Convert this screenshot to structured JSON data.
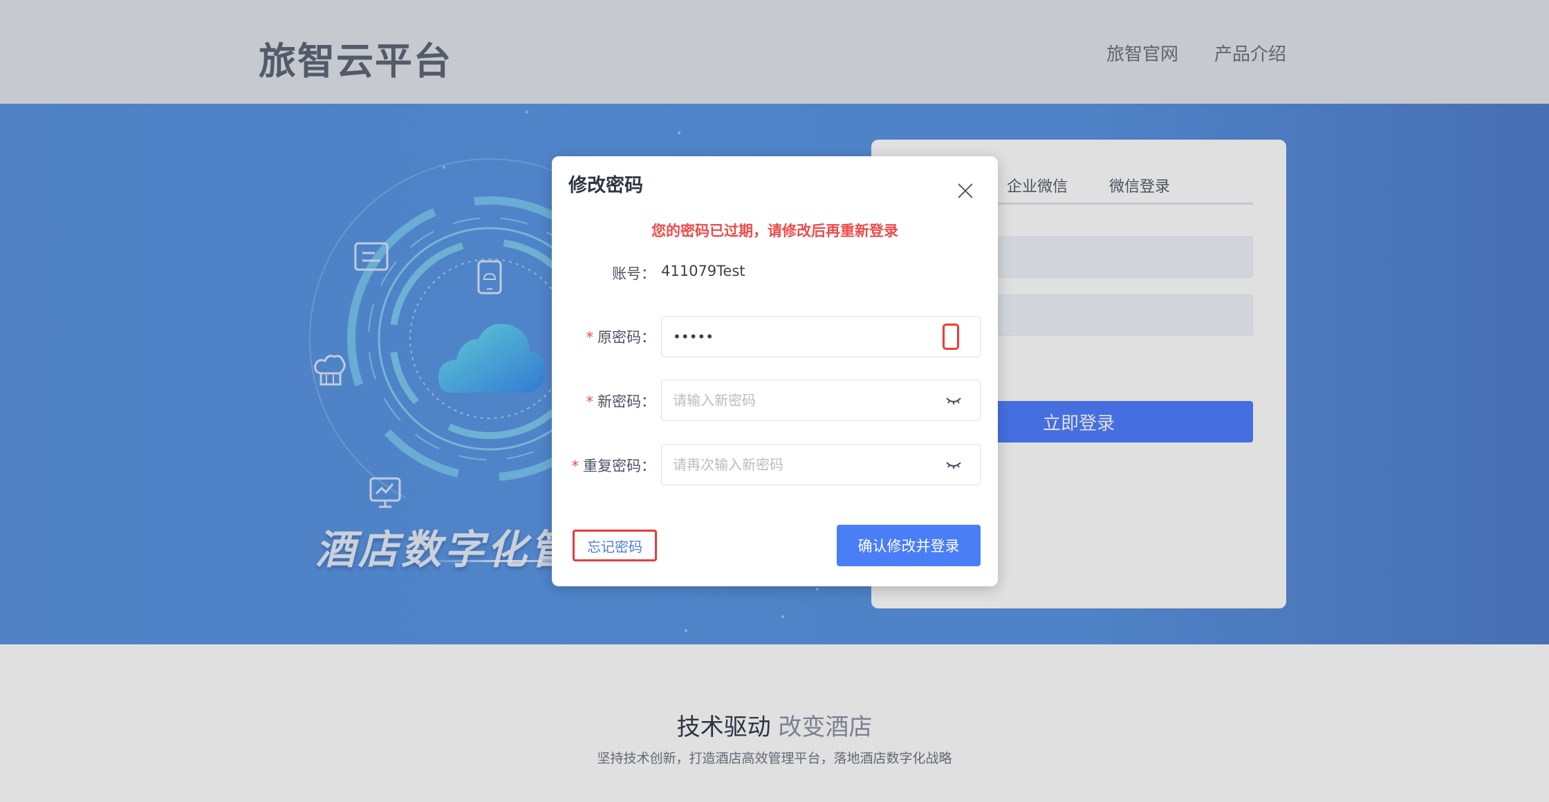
{
  "header": {
    "logo": "旅智云平台",
    "nav": [
      "旅智官网",
      "产品介绍"
    ]
  },
  "banner": {
    "slogan": "酒店数字化管"
  },
  "login_card": {
    "tabs": [
      "企业微信",
      "微信登录"
    ],
    "login_button": "立即登录"
  },
  "section": {
    "title_dark": "技术驱动",
    "title_light": "改变酒店",
    "subtitle": "坚持技术创新，打造酒店高效管理平台，落地酒店数字化战略"
  },
  "modal": {
    "title": "修改密码",
    "warning": "您的密码已过期，请修改后再重新登录",
    "account_label": "账号：",
    "account_value": "411079Test",
    "old_pw_label": "原密码：",
    "old_pw_value": "•••••",
    "new_pw_label": "新密码：",
    "new_pw_placeholder": "请输入新密码",
    "repeat_pw_label": "重复密码：",
    "repeat_pw_placeholder": "请再次输入新密码",
    "required_mark": "*",
    "forgot_button": "忘记密码",
    "confirm_button": "确认修改并登录"
  },
  "colors": {
    "primary": "#4a7ef7",
    "danger": "#f04a4a",
    "banner": "#5a93e0"
  },
  "icons": [
    "close-icon",
    "phone-icon",
    "eye-closed-icon",
    "cloud-icon",
    "chef-hat-icon",
    "monitor-chart-icon",
    "document-icon",
    "mobile-cloud-icon"
  ]
}
